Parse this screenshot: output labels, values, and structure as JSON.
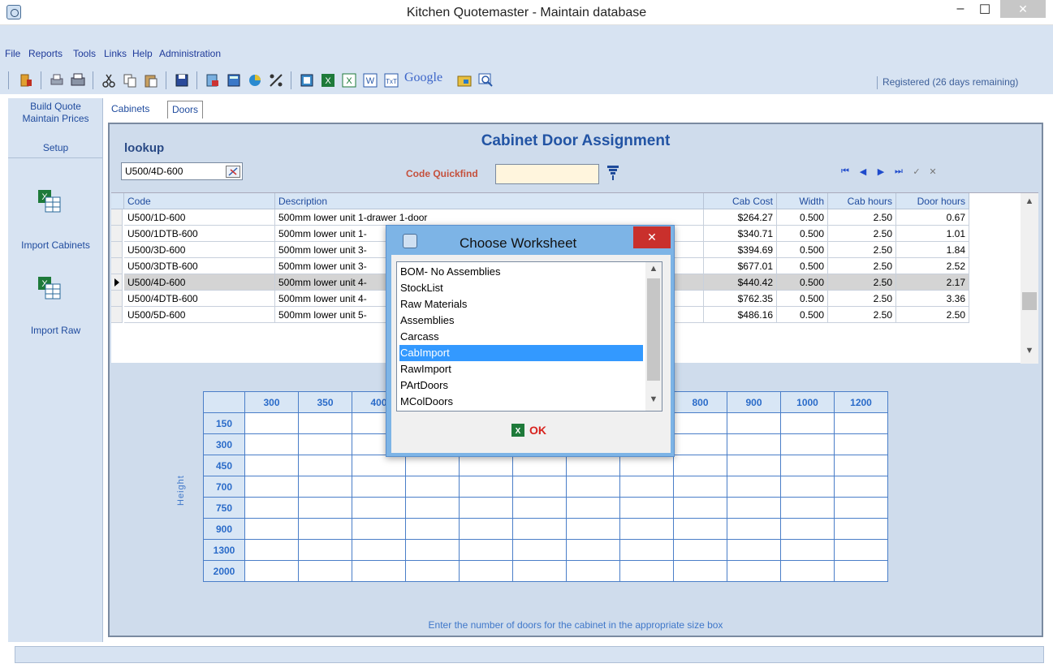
{
  "window": {
    "title": "Kitchen Quotemaster - Maintain database",
    "min": "–",
    "max": "☐",
    "close": "✕"
  },
  "menu": {
    "items": [
      "File",
      "Reports",
      "Tools",
      "Links",
      "Help",
      "Administration"
    ]
  },
  "toolbar": {
    "google_label": "Google",
    "registered": "Registered (26 days remaining)"
  },
  "left_nav": {
    "items": [
      "Build Quote",
      "Maintain Prices",
      "Setup"
    ],
    "import_cabinets": "Import Cabinets",
    "import_raw": "Import Raw"
  },
  "tabs": [
    "Cabinets",
    "Doors"
  ],
  "panel": {
    "title": "Cabinet Door Assignment",
    "lookup_label": "lookup",
    "lookup_value": "U500/4D-600",
    "quickfind_label": "Code Quickfind",
    "quickfind_value": ""
  },
  "grid": {
    "columns": [
      "Code",
      "Description",
      "Cab Cost",
      "Width",
      "Cab hours",
      "Door hours"
    ],
    "rows": [
      {
        "code": "U500/1D-600",
        "desc": "500mm lower unit 1-drawer 1-door",
        "cost": "$264.27",
        "width": "0.500",
        "cabh": "2.50",
        "doorh": "0.67"
      },
      {
        "code": "U500/1DTB-600",
        "desc": "500mm lower unit 1-",
        "cost": "$340.71",
        "width": "0.500",
        "cabh": "2.50",
        "doorh": "1.01"
      },
      {
        "code": "U500/3D-600",
        "desc": "500mm lower unit 3-",
        "cost": "$394.69",
        "width": "0.500",
        "cabh": "2.50",
        "doorh": "1.84"
      },
      {
        "code": "U500/3DTB-600",
        "desc": "500mm lower unit 3-",
        "cost": "$677.01",
        "width": "0.500",
        "cabh": "2.50",
        "doorh": "2.52"
      },
      {
        "code": "U500/4D-600",
        "desc": "500mm lower unit 4-",
        "cost": "$440.42",
        "width": "0.500",
        "cabh": "2.50",
        "doorh": "2.17"
      },
      {
        "code": "U500/4DTB-600",
        "desc": "500mm lower unit 4-",
        "cost": "$762.35",
        "width": "0.500",
        "cabh": "2.50",
        "doorh": "3.36"
      },
      {
        "code": "U500/5D-600",
        "desc": "500mm lower unit 5-",
        "cost": "$486.16",
        "width": "0.500",
        "cabh": "2.50",
        "doorh": "2.50"
      }
    ],
    "selected_index": 4
  },
  "size_table": {
    "widths": [
      "300",
      "350",
      "400",
      "",
      "",
      "",
      "",
      "",
      "800",
      "900",
      "1000",
      "1200"
    ],
    "heights": [
      "150",
      "300",
      "450",
      "700",
      "750",
      "900",
      "1300",
      "2000"
    ],
    "height_label": "Height",
    "hint": "Enter the number of doors for the cabinet in the appropriate size box"
  },
  "dialog": {
    "title": "Choose Worksheet",
    "close": "✕",
    "items": [
      "BOM- No Assemblies",
      "StockList",
      "Raw Materials",
      "Assemblies",
      "Carcass",
      "CabImport",
      "RawImport",
      "PArtDoors",
      "MColDoors"
    ],
    "selected": "CabImport",
    "ok_label": "OK"
  }
}
